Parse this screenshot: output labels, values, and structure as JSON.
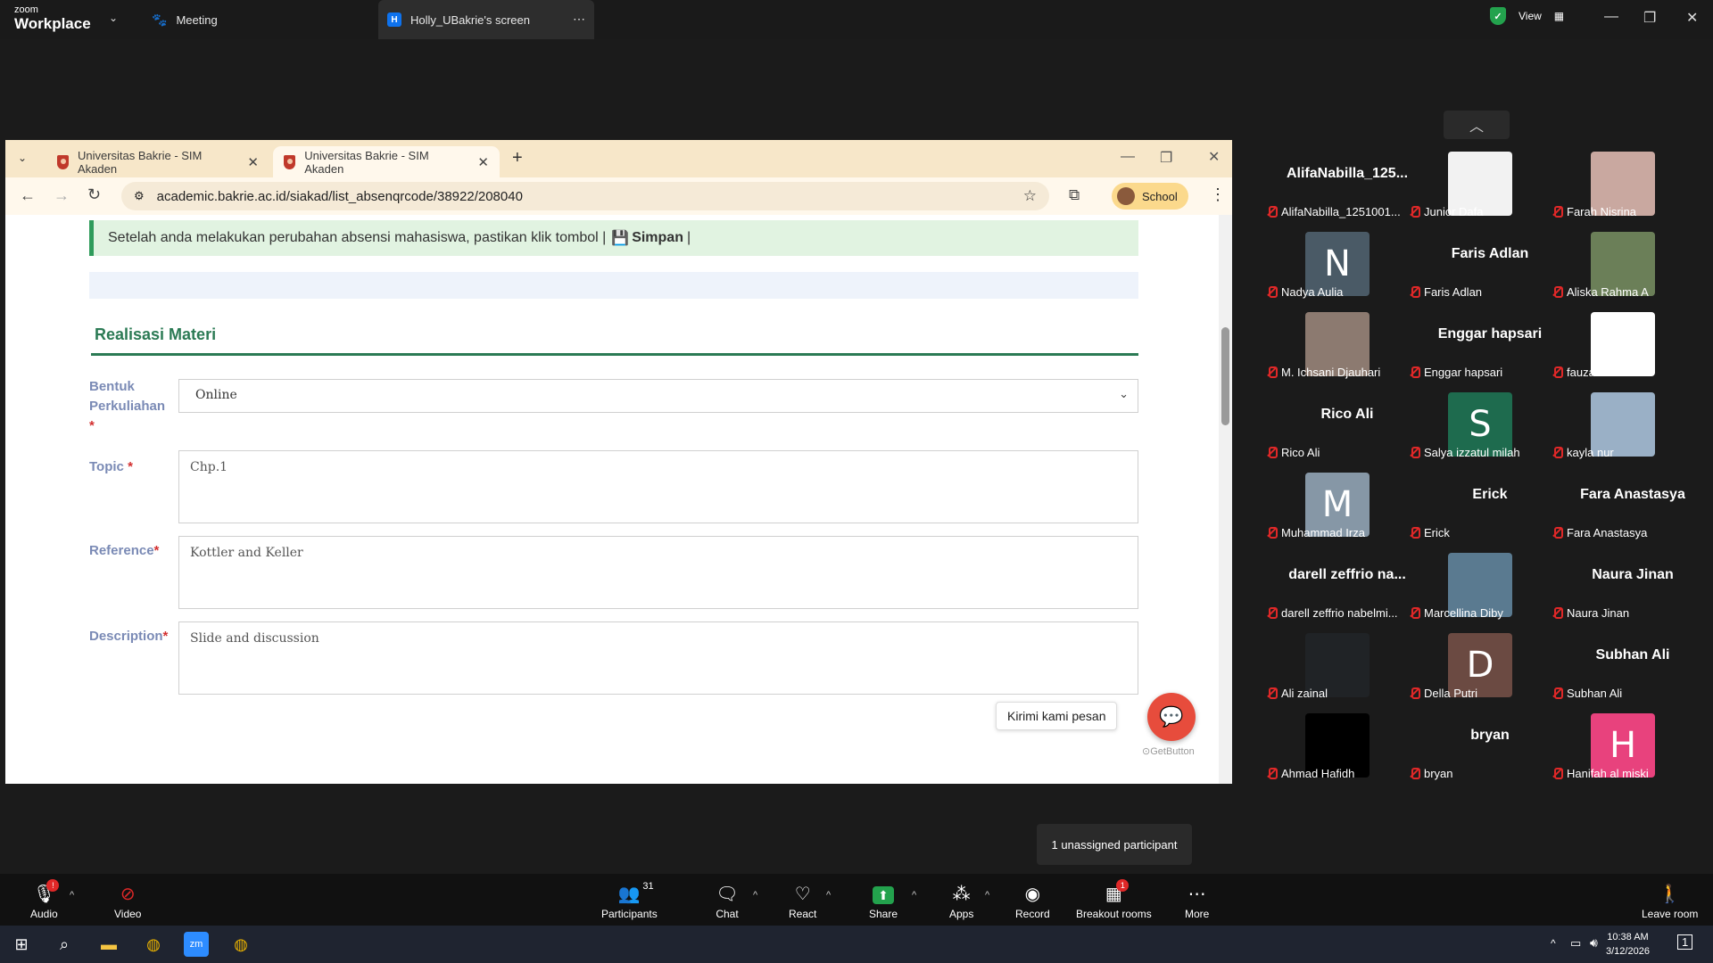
{
  "zoom_top": {
    "logo_small": "zoom",
    "logo_large": "Workplace",
    "meeting_tab": "Meeting",
    "screen_tab": "Holly_UBakrie's screen",
    "screen_tab_initial": "H",
    "view_label": "View"
  },
  "browser": {
    "tabs": [
      {
        "label": "Universitas Bakrie - SIM Akaden"
      },
      {
        "label": "Universitas Bakrie - SIM Akaden"
      }
    ],
    "url": "academic.bakrie.ac.id/siakad/list_absenqrcode/38922/208040",
    "profile_label": "School"
  },
  "page": {
    "alert_text": "Setelah anda melakukan perubahan absensi mahasiswa, pastikan klik tombol |",
    "alert_save": "Simpan",
    "alert_tail": "|",
    "section_title": "Realisasi Materi",
    "fields": {
      "bentuk_label_1": "Bentuk",
      "bentuk_label_2": "Perkuliahan",
      "bentuk_value": "Online",
      "topic_label": "Topic",
      "topic_value": "Chp.1",
      "reference_label": "Reference",
      "reference_value": "Kottler and Keller",
      "description_label": "Description",
      "description_value": "Slide and discussion",
      "required_mark": "*"
    },
    "chat_bubble": "Kirimi kami pesan",
    "getbutton": "GetButton"
  },
  "gallery": {
    "participants": [
      {
        "big": "AlifaNabilla_125...",
        "name": "AlifaNabilla_1251001...",
        "thumb": "",
        "color": ""
      },
      {
        "big": "",
        "name": "Junior Dafa",
        "thumb": "",
        "color": "#f2f2f2"
      },
      {
        "big": "",
        "name": "Farah Nisrina",
        "thumb": "",
        "color": "#c9a8a0"
      },
      {
        "big": "",
        "name": "Nadya Aulia",
        "thumb": "N",
        "color": "#4a5a66"
      },
      {
        "big": "Faris Adlan",
        "name": "Faris Adlan",
        "thumb": "",
        "color": ""
      },
      {
        "big": "",
        "name": "Aliska Rahma A",
        "thumb": "",
        "color": "#6b7f58"
      },
      {
        "big": "",
        "name": "M. Ichsani Djauhari",
        "thumb": "",
        "color": "#8c7a70"
      },
      {
        "big": "Enggar hapsari",
        "name": "Enggar hapsari",
        "thumb": "",
        "color": ""
      },
      {
        "big": "",
        "name": "fauzan akmal",
        "thumb": "",
        "color": "#ffffff"
      },
      {
        "big": "Rico Ali",
        "name": "Rico Ali",
        "thumb": "",
        "color": ""
      },
      {
        "big": "",
        "name": "Salya izzatul milah",
        "thumb": "S",
        "color": "#1e6b4e"
      },
      {
        "big": "",
        "name": "kayla nur",
        "thumb": "",
        "color": "#9ab0c6"
      },
      {
        "big": "",
        "name": "Muhammad Irza",
        "thumb": "M",
        "color": "#8697a6"
      },
      {
        "big": "Erick",
        "name": "Erick",
        "thumb": "",
        "color": ""
      },
      {
        "big": "Fara Anastasya",
        "name": "Fara Anastasya",
        "thumb": "",
        "color": ""
      },
      {
        "big": "darell zeffrio na...",
        "name": "darell zeffrio nabelmi...",
        "thumb": "",
        "color": ""
      },
      {
        "big": "",
        "name": "Marcellina Diby",
        "thumb": "",
        "color": "#5a7a90"
      },
      {
        "big": "Naura Jinan",
        "name": "Naura Jinan",
        "thumb": "",
        "color": ""
      },
      {
        "big": "",
        "name": "Ali zainal",
        "thumb": "",
        "color": "#202326"
      },
      {
        "big": "",
        "name": "Della Putri",
        "thumb": "D",
        "color": "#6b4a42"
      },
      {
        "big": "Subhan Ali",
        "name": "Subhan Ali",
        "thumb": "",
        "color": ""
      },
      {
        "big": "",
        "name": "Ahmad Hafidh",
        "thumb": "",
        "color": "#000000"
      },
      {
        "big": "bryan",
        "name": "bryan",
        "thumb": "",
        "color": ""
      },
      {
        "big": "",
        "name": "Hanifah al miski",
        "thumb": "H",
        "color": "#e8427d"
      }
    ],
    "unassigned": "1 unassigned participant"
  },
  "zoom_bar": {
    "audio": "Audio",
    "video": "Video",
    "participants": "Participants",
    "participants_count": "31",
    "chat": "Chat",
    "react": "React",
    "share": "Share",
    "apps": "Apps",
    "record": "Record",
    "breakout": "Breakout rooms",
    "breakout_badge": "1",
    "more": "More",
    "leave": "Leave room"
  },
  "taskbar": {
    "time": "10:38 AM",
    "date": "3/12/2026",
    "notif_count": "1"
  }
}
